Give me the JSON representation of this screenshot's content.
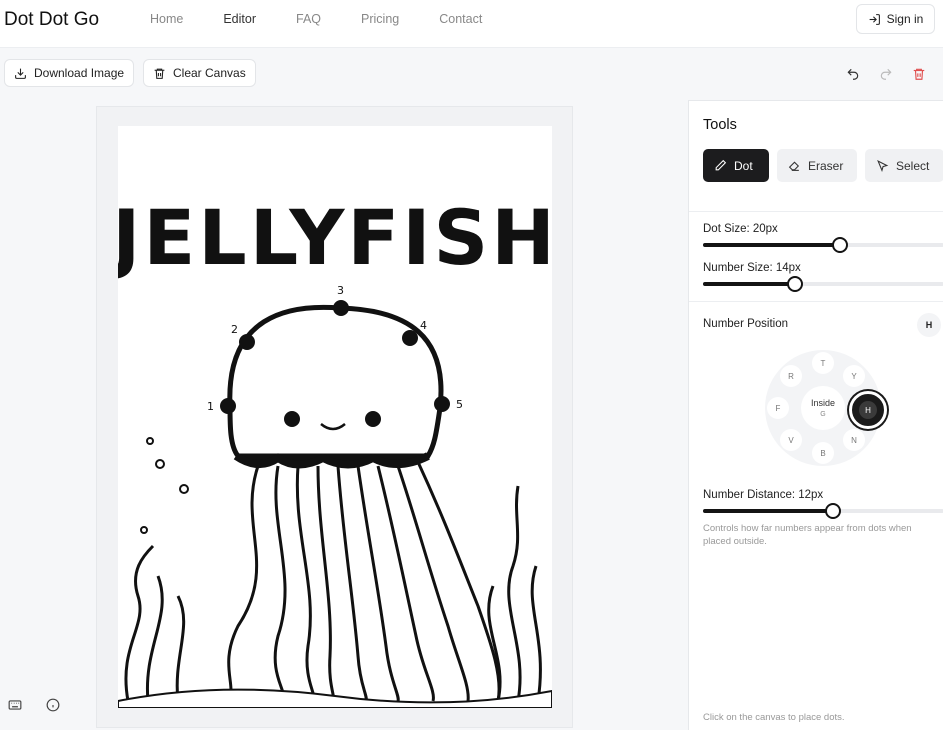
{
  "app": {
    "brand": "Dot Dot Go"
  },
  "nav": {
    "items": [
      "Home",
      "Editor",
      "FAQ",
      "Pricing",
      "Contact"
    ],
    "active": "Editor"
  },
  "auth": {
    "signin_label": "Sign in"
  },
  "toolbar": {
    "download_label": "Download Image",
    "clear_label": "Clear Canvas"
  },
  "canvas": {
    "heading": "JELLYFISH",
    "dots": [
      {
        "number": "1"
      },
      {
        "number": "2"
      },
      {
        "number": "3"
      },
      {
        "number": "4"
      },
      {
        "number": "5"
      }
    ]
  },
  "panel": {
    "title": "Tools",
    "tools": [
      {
        "label": "Dot",
        "icon": "pencil-icon",
        "active": true
      },
      {
        "label": "Eraser",
        "icon": "eraser-icon",
        "active": false
      },
      {
        "label": "Select",
        "icon": "cursor-icon",
        "active": false
      }
    ],
    "dot_size": {
      "label": "Dot Size: 20px",
      "fraction": 0.57
    },
    "number_size": {
      "label": "Number Size: 14px",
      "fraction": 0.38
    },
    "number_position": {
      "label": "Number Position",
      "current": "H",
      "keys": [
        "T",
        "Y",
        "R",
        "F",
        "V",
        "B",
        "N"
      ],
      "center_label": "Inside",
      "center_key": "G",
      "active_key": "H"
    },
    "number_distance": {
      "label": "Number Distance: 12px",
      "fraction": 0.54,
      "hint": "Controls how far numbers appear from dots when placed outside."
    },
    "footer_hint": "Click on the canvas to place dots."
  },
  "colors": {
    "primary": "#1c1c1e",
    "danger": "#e05050",
    "muted": "#888888"
  }
}
